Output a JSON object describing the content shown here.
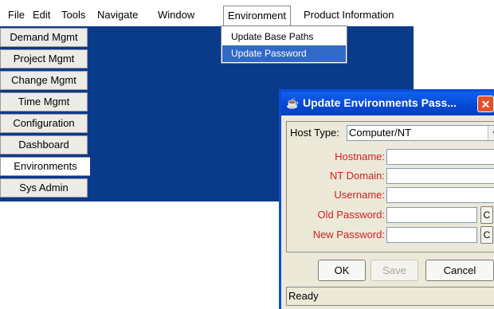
{
  "menubar": {
    "items": [
      "File",
      "Edit",
      "Tools",
      "Navigate",
      "Window",
      "Environment",
      "Product Information"
    ]
  },
  "nav": {
    "items": [
      "Demand Mgmt",
      "Project Mgmt",
      "Change Mgmt",
      "Time Mgmt",
      "Configuration",
      "Dashboard",
      "Environments",
      "Sys Admin"
    ],
    "active": "Environments"
  },
  "environment_menu": {
    "items": [
      "Update Base Paths",
      "Update Password"
    ],
    "highlighted": "Update Password"
  },
  "dialog": {
    "title": "Update Environments Pass...",
    "close_symbol": "✕",
    "host_type_label": "Host Type:",
    "host_type_value": "Computer/NT",
    "fields": {
      "hostname": "Hostname:",
      "nt_domain": "NT Domain:",
      "username": "Username:",
      "old_password": "Old Password:",
      "new_password": "New Password:"
    },
    "c_label": "C",
    "buttons": {
      "ok": "OK",
      "save": "Save",
      "cancel": "Cancel"
    },
    "status": "Ready"
  },
  "colors": {
    "workspace": "#0a3a8a",
    "highlight": "#3169c6",
    "field_label": "#d42020",
    "titlebar": "#0747d1"
  }
}
